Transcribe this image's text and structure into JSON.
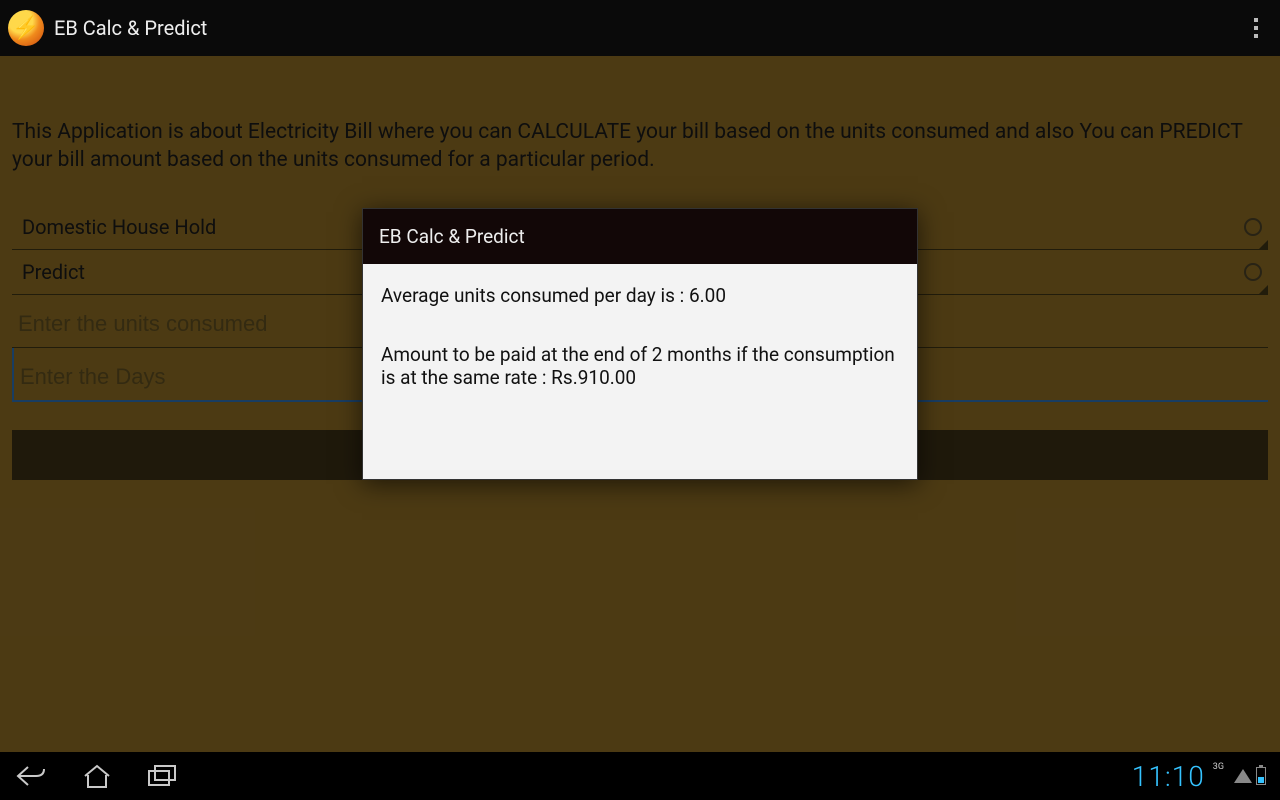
{
  "actionbar": {
    "title": "EB Calc & Predict",
    "icon_glyph": "⚡"
  },
  "intro": "This Application is about Electricity Bill where you can CALCULATE your bill based on the units consumed and also You can PREDICT your bill amount based on the units consumed for a particular period.",
  "dropdowns": {
    "category": "Domestic House Hold",
    "mode": "Predict"
  },
  "inputs": {
    "units_placeholder": "Enter the units consumed",
    "days_placeholder": "Enter the Days"
  },
  "dialog": {
    "title": "EB Calc & Predict",
    "line1": "Average units consumed per day is : 6.00",
    "line2": "Amount to be paid at the end of 2 months if the consumption is at the same rate : Rs.910.00"
  },
  "statusbar": {
    "time": "11:10",
    "network": "3G"
  }
}
